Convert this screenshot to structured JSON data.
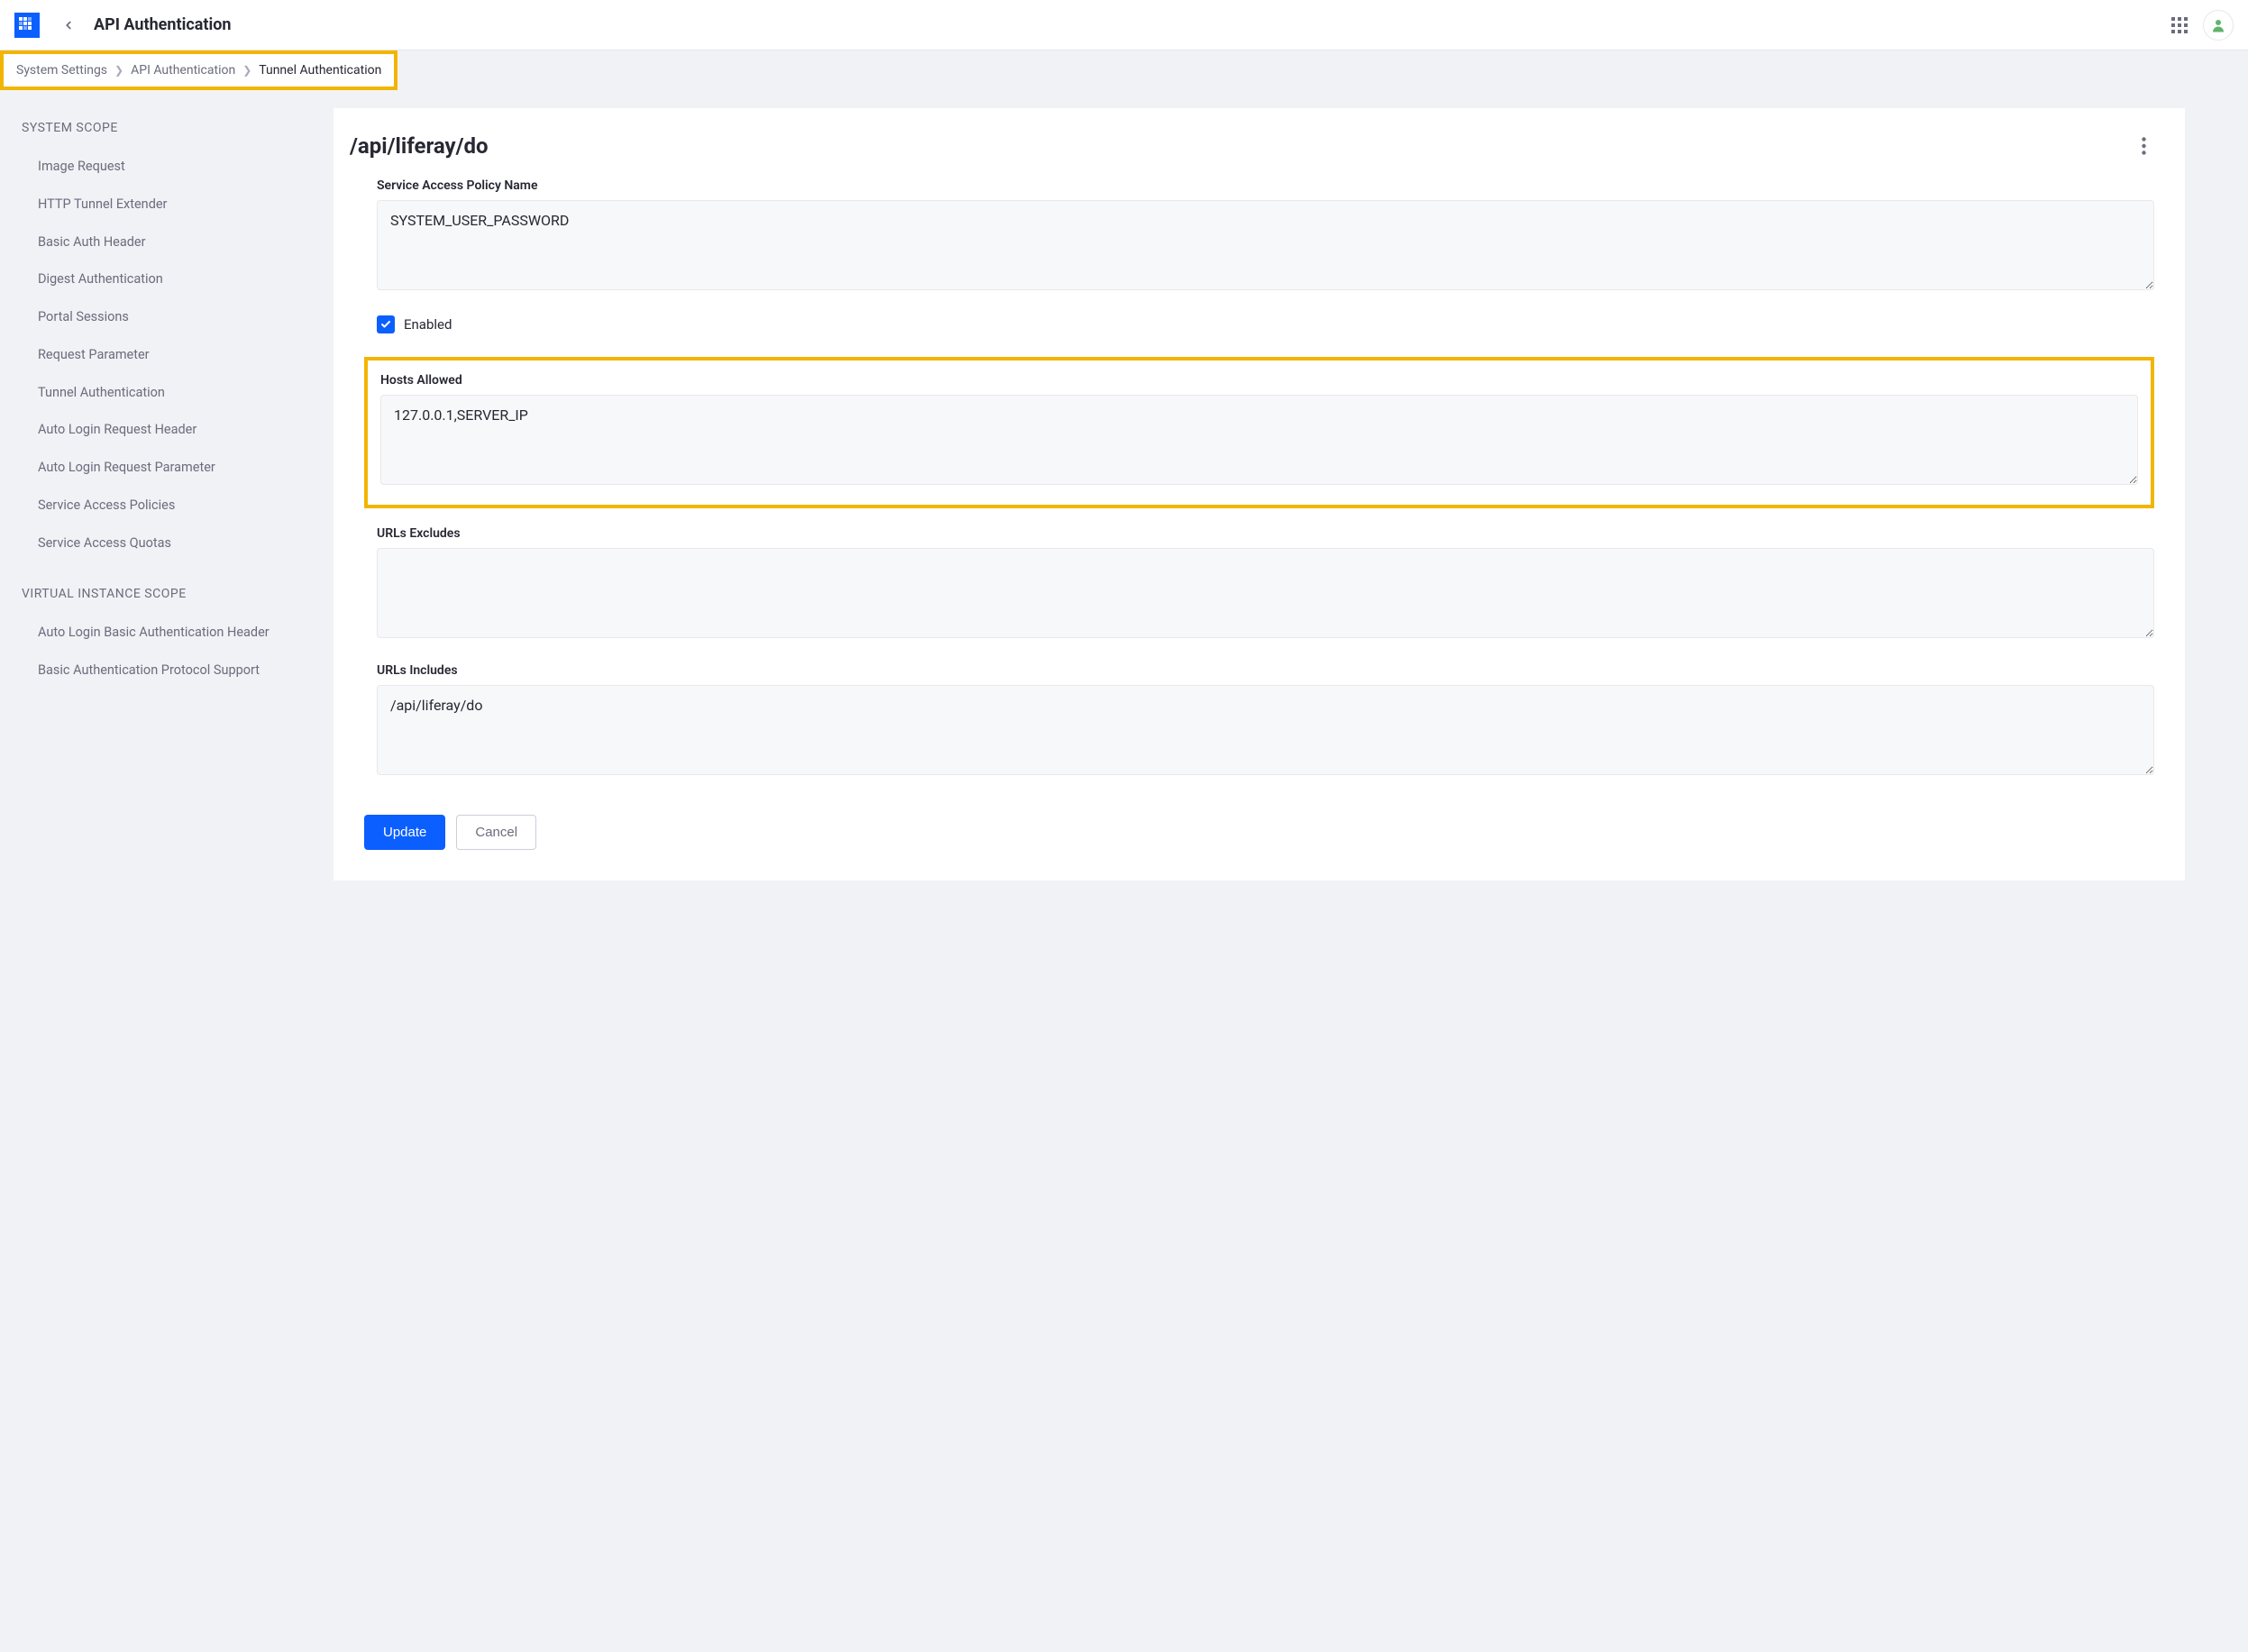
{
  "topbar": {
    "title": "API Authentication"
  },
  "breadcrumb": {
    "items": [
      "System Settings",
      "API Authentication",
      "Tunnel Authentication"
    ]
  },
  "sidebar": {
    "scopes": [
      {
        "label": "SYSTEM SCOPE",
        "items": [
          "Image Request",
          "HTTP Tunnel Extender",
          "Basic Auth Header",
          "Digest Authentication",
          "Portal Sessions",
          "Request Parameter",
          "Tunnel Authentication",
          "Auto Login Request Header",
          "Auto Login Request Parameter",
          "Service Access Policies",
          "Service Access Quotas"
        ]
      },
      {
        "label": "VIRTUAL INSTANCE SCOPE",
        "items": [
          "Auto Login Basic Authentication Header",
          "Basic Authentication Protocol Support"
        ]
      }
    ]
  },
  "panel": {
    "title": "/api/liferay/do",
    "fields": {
      "service_access_policy_name": {
        "label": "Service Access Policy Name",
        "value": "SYSTEM_USER_PASSWORD"
      },
      "enabled": {
        "label": "Enabled",
        "checked": true
      },
      "hosts_allowed": {
        "label": "Hosts Allowed",
        "value": "127.0.0.1,SERVER_IP"
      },
      "urls_excludes": {
        "label": "URLs Excludes",
        "value": ""
      },
      "urls_includes": {
        "label": "URLs Includes",
        "value": "/api/liferay/do"
      }
    },
    "buttons": {
      "update": "Update",
      "cancel": "Cancel"
    }
  }
}
